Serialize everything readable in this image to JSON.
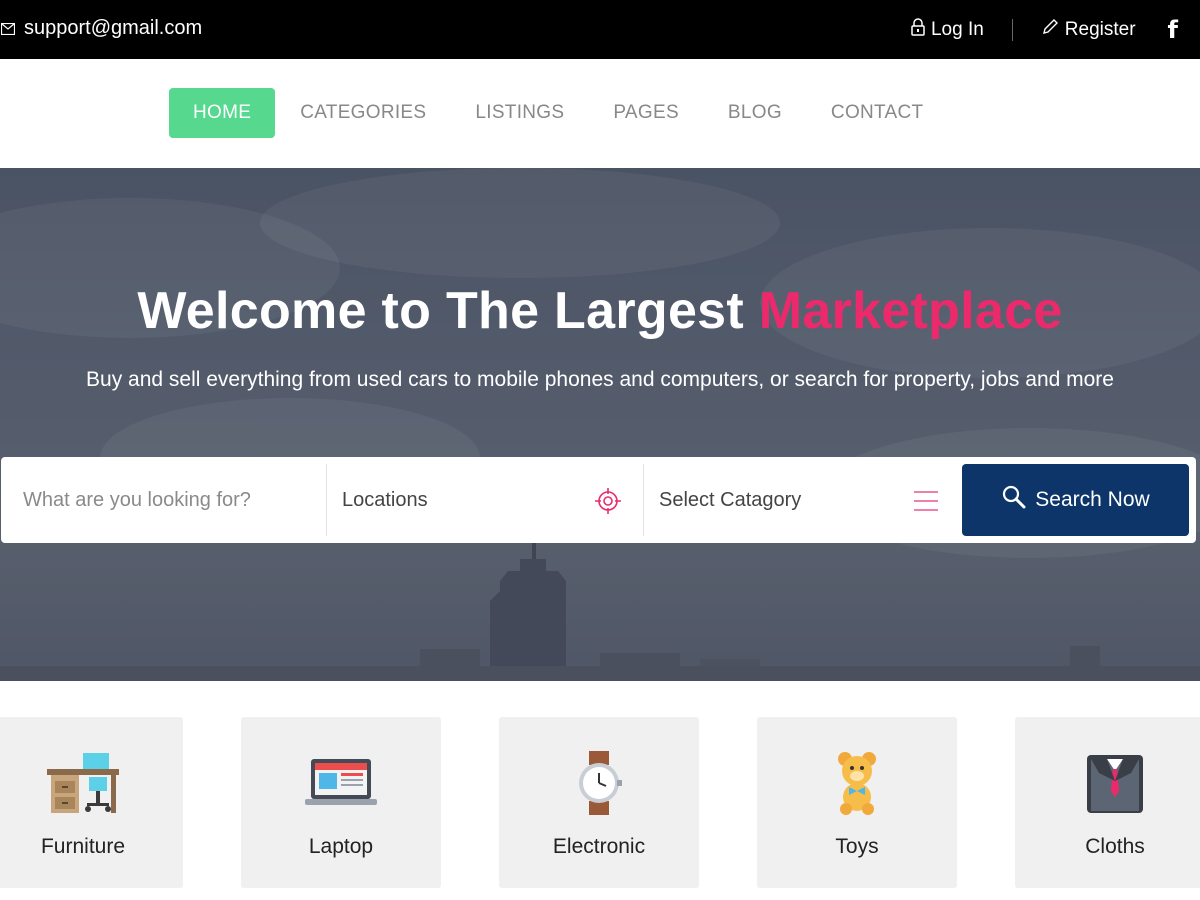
{
  "topbar": {
    "email": "support@gmail.com",
    "login": "Log In",
    "register": "Register",
    "facebook": "f"
  },
  "nav": {
    "items": [
      "HOME",
      "CATEGORIES",
      "LISTINGS",
      "PAGES",
      "BLOG",
      "CONTACT"
    ],
    "active": "HOME"
  },
  "hero": {
    "title_main": "Welcome to The Largest ",
    "title_accent": "Marketplace",
    "subtitle": "Buy and sell everything from used cars to mobile phones and computers, or search for property, jobs and more"
  },
  "search": {
    "what_placeholder": "What are you looking for?",
    "location": "Locations",
    "category": "Select Catagory",
    "button": "Search Now"
  },
  "categories": [
    {
      "label": "Furniture",
      "icon": "furniture-icon"
    },
    {
      "label": "Laptop",
      "icon": "laptop-icon"
    },
    {
      "label": "Electronic",
      "icon": "watch-icon"
    },
    {
      "label": "Toys",
      "icon": "teddy-bear-icon"
    },
    {
      "label": "Cloths",
      "icon": "suit-icon"
    }
  ],
  "colors": {
    "accent": "#ec2a6b",
    "nav_active": "#56d88e",
    "search_button": "#0d3569"
  }
}
